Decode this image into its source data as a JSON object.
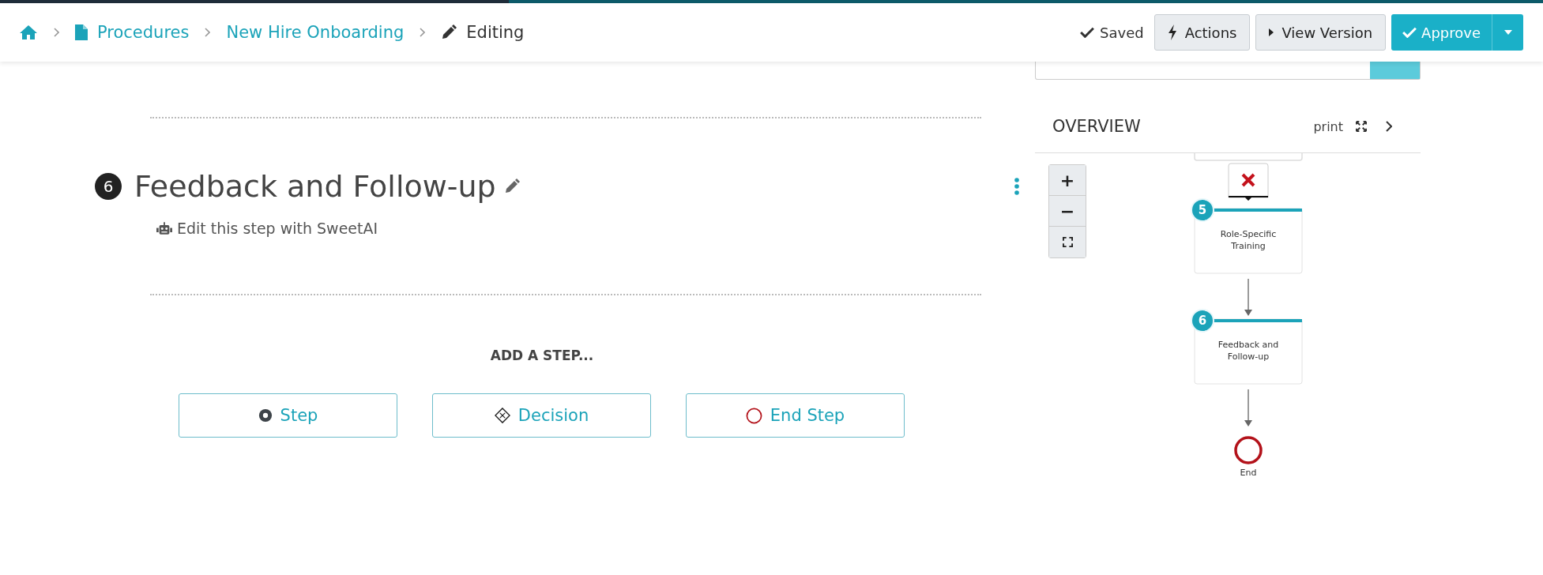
{
  "breadcrumb": [
    {
      "label": "Procedures",
      "kind": "document"
    },
    {
      "label": "New Hire Onboarding",
      "kind": "link"
    },
    {
      "label": "Editing",
      "kind": "current"
    }
  ],
  "header_actions": {
    "status": "Saved",
    "buttons": [
      {
        "label": "Actions",
        "kind": "bolt"
      },
      {
        "label": "View Version",
        "kind": "play"
      }
    ],
    "primary": "Approve"
  },
  "step": {
    "number": "6",
    "title": "Feedback and Follow-up",
    "ai_link": "Edit this step with SweetAI"
  },
  "add_step": {
    "heading": "ADD A STEP...",
    "options": [
      {
        "label": "Step",
        "kind": "step"
      },
      {
        "label": "Decision",
        "kind": "decision"
      },
      {
        "label": "End Step",
        "kind": "end"
      }
    ]
  },
  "overview": {
    "title": "OVERVIEW",
    "print": "print",
    "zoom_controls": [
      {
        "label": "+",
        "kind": "in"
      },
      {
        "label": "−",
        "kind": "out"
      },
      {
        "kind": "fit"
      }
    ],
    "nodes": [
      {
        "number": "5",
        "lines": [
          "Role-Specific",
          "Training"
        ]
      },
      {
        "number": "6",
        "lines": [
          "Feedback and",
          "Follow-up"
        ]
      }
    ],
    "end_label": "End"
  }
}
